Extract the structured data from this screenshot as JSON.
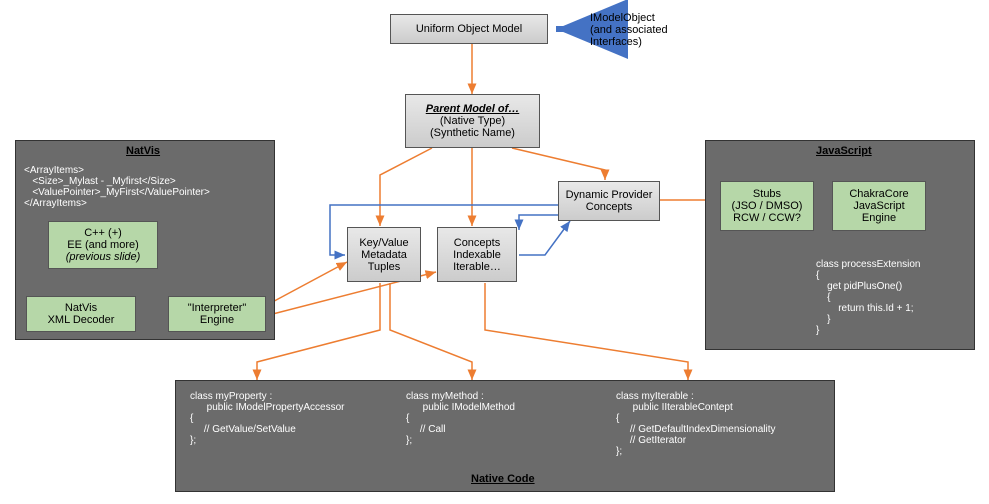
{
  "top": {
    "uniform_label": "Uniform Object Model",
    "annotation_line1": "IModelObject",
    "annotation_line2": "(and associated",
    "annotation_line3": "Interfaces)"
  },
  "parent": {
    "title": "Parent Model of…",
    "line2": "(Native Type)",
    "line3": "(Synthetic Name)"
  },
  "center": {
    "dynamic_provider_l1": "Dynamic Provider",
    "dynamic_provider_l2": "Concepts",
    "keyvalue_l1": "Key/Value",
    "keyvalue_l2": "Metadata",
    "keyvalue_l3": "Tuples",
    "concepts_l1": "Concepts",
    "concepts_l2": "Indexable",
    "concepts_l3": "Iterable…"
  },
  "natvis": {
    "title": "NatVis",
    "xml_code": "<ArrayItems>\n   <Size>_Mylast - _Myfirst</Size>\n   <ValuePointer>_MyFirst</ValuePointer>\n</ArrayItems>",
    "cpp_l1": "C++ (+)",
    "cpp_l2": "EE (and more)",
    "cpp_l3": "(previous slide)",
    "decoder_l1": "NatVis",
    "decoder_l2": "XML Decoder",
    "interpreter_l1": "\"Interpreter\"",
    "interpreter_l2": "Engine"
  },
  "js": {
    "title": "JavaScript",
    "stubs_l1": "Stubs",
    "stubs_l2": "(JSO / DMSO)",
    "stubs_l3": "RCW / CCW?",
    "chakra_l1": "ChakraCore",
    "chakra_l2": "JavaScript",
    "chakra_l3": "Engine",
    "code": "class processExtension\n{\n    get pidPlusOne()\n    {\n        return this.Id + 1;\n    }\n}"
  },
  "native": {
    "title": "Native Code",
    "prop_code": "class myProperty :\n      public IModelPropertyAccessor\n{\n     // GetValue/SetValue\n};",
    "method_code": "class myMethod :\n      public IModelMethod\n{\n     // Call\n};",
    "iter_code": "class myIterable :\n      public IIterableContept\n{\n     // GetDefaultIndexDimensionality\n     // GetIterator\n};"
  }
}
